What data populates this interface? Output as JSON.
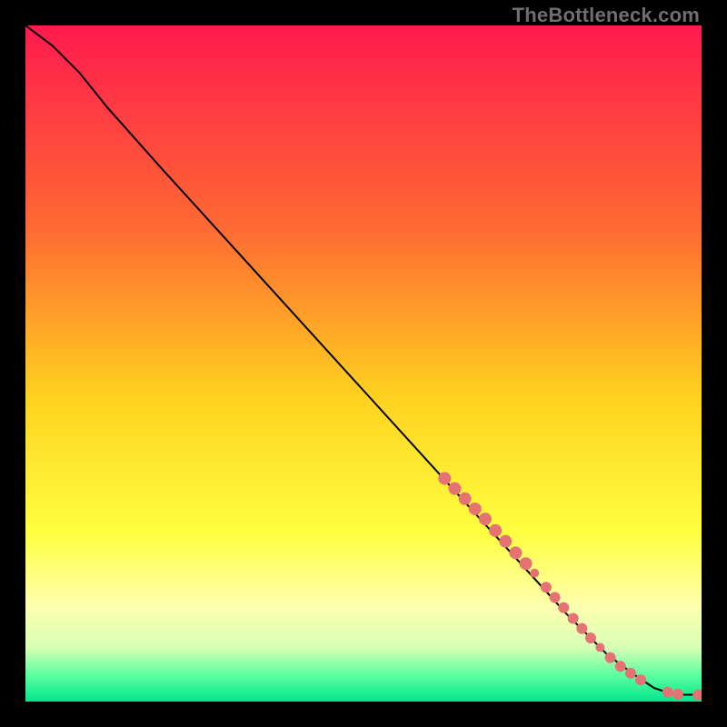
{
  "watermark": "TheBottleneck.com",
  "chart_data": {
    "type": "line",
    "title": "",
    "xlabel": "",
    "ylabel": "",
    "xlim": [
      0,
      100
    ],
    "ylim": [
      0,
      100
    ],
    "grid": false,
    "background_gradient": {
      "stops": [
        {
          "offset": 0.0,
          "color": "#ff1a4e"
        },
        {
          "offset": 0.3,
          "color": "#ff6a33"
        },
        {
          "offset": 0.55,
          "color": "#ffd21f"
        },
        {
          "offset": 0.75,
          "color": "#ffff40"
        },
        {
          "offset": 0.86,
          "color": "#ffffb0"
        },
        {
          "offset": 0.92,
          "color": "#d7ffb5"
        },
        {
          "offset": 0.96,
          "color": "#5fffa0"
        },
        {
          "offset": 1.0,
          "color": "#00e68c"
        }
      ]
    },
    "series": [
      {
        "name": "curve",
        "stroke": "#000000",
        "stroke_width": 2,
        "x": [
          0,
          4,
          8,
          12,
          20,
          30,
          40,
          50,
          60,
          70,
          80,
          86,
          90,
          93,
          96,
          98,
          100
        ],
        "y": [
          100,
          97,
          93,
          88,
          79,
          68,
          57,
          46,
          35,
          24,
          13,
          7,
          4,
          2,
          1,
          1,
          1
        ]
      }
    ],
    "markers": {
      "name": "highlight-points",
      "color": "#e57373",
      "radius_base": 6,
      "points": [
        {
          "x": 62,
          "y": 33,
          "r": 7
        },
        {
          "x": 63.5,
          "y": 31.5,
          "r": 7
        },
        {
          "x": 65,
          "y": 30,
          "r": 7
        },
        {
          "x": 66.5,
          "y": 28.5,
          "r": 7
        },
        {
          "x": 68,
          "y": 27,
          "r": 7
        },
        {
          "x": 69.5,
          "y": 25.3,
          "r": 7
        },
        {
          "x": 71,
          "y": 23.7,
          "r": 7
        },
        {
          "x": 72.5,
          "y": 22,
          "r": 7
        },
        {
          "x": 74,
          "y": 20.4,
          "r": 7
        },
        {
          "x": 75.3,
          "y": 19,
          "r": 5
        },
        {
          "x": 77,
          "y": 16.9,
          "r": 6
        },
        {
          "x": 78.3,
          "y": 15.4,
          "r": 6
        },
        {
          "x": 79.6,
          "y": 13.9,
          "r": 6
        },
        {
          "x": 81,
          "y": 12.3,
          "r": 6
        },
        {
          "x": 82.3,
          "y": 10.8,
          "r": 6
        },
        {
          "x": 83.6,
          "y": 9.4,
          "r": 6
        },
        {
          "x": 85,
          "y": 8,
          "r": 5
        },
        {
          "x": 86.5,
          "y": 6.5,
          "r": 6
        },
        {
          "x": 88,
          "y": 5.2,
          "r": 6
        },
        {
          "x": 89.5,
          "y": 4.2,
          "r": 6
        },
        {
          "x": 91,
          "y": 3.2,
          "r": 6
        },
        {
          "x": 95,
          "y": 1.4,
          "r": 6
        },
        {
          "x": 96.5,
          "y": 1.1,
          "r": 6
        },
        {
          "x": 99.5,
          "y": 1.0,
          "r": 6
        }
      ]
    }
  }
}
